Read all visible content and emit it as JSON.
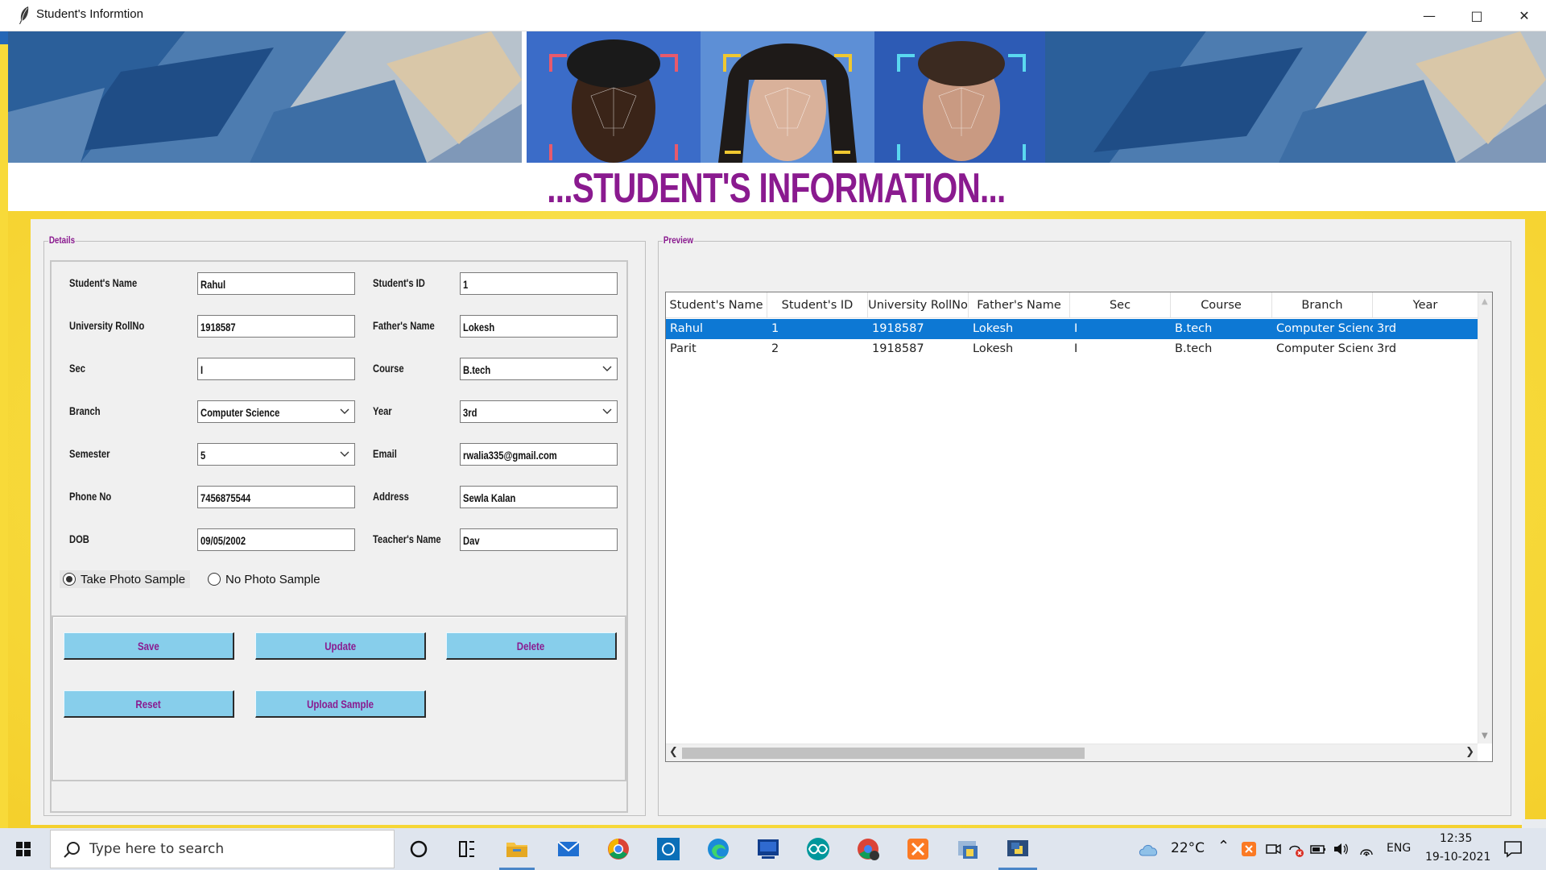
{
  "window": {
    "title": "Student's Informtion"
  },
  "heading": "...STUDENT'S INFORMATION...",
  "details": {
    "group_label": "Details",
    "fields": {
      "student_name": {
        "label": "Student's Name",
        "value": "Rahul"
      },
      "student_id": {
        "label": "Student's ID",
        "value": "1"
      },
      "university_rollno": {
        "label": "University RollNo",
        "value": "1918587"
      },
      "father_name": {
        "label": "Father's Name",
        "value": "Lokesh"
      },
      "sec": {
        "label": "Sec",
        "value": "I"
      },
      "course": {
        "label": "Course",
        "value": "B.tech"
      },
      "branch": {
        "label": "Branch",
        "value": "Computer Science"
      },
      "year": {
        "label": "Year",
        "value": "3rd"
      },
      "semester": {
        "label": "Semester",
        "value": "5"
      },
      "email": {
        "label": "Email",
        "value": "rwalia335@gmail.com"
      },
      "phone": {
        "label": "Phone No",
        "value": "7456875544"
      },
      "address": {
        "label": "Address",
        "value": "Sewla Kalan"
      },
      "dob": {
        "label": "DOB",
        "value": "09/05/2002"
      },
      "teacher": {
        "label": "Teacher's Name",
        "value": "Dav"
      }
    },
    "radios": {
      "take_photo": {
        "label": "Take Photo Sample",
        "selected": true
      },
      "no_photo": {
        "label": "No Photo Sample",
        "selected": false
      }
    },
    "buttons": {
      "save": "Save",
      "update": "Update",
      "delete": "Delete",
      "reset": "Reset",
      "upload": "Upload Sample"
    }
  },
  "preview": {
    "group_label": "Preview",
    "columns": [
      "Student's Name",
      "Student's ID",
      "University RollNo",
      "Father's Name",
      "Sec",
      "Course",
      "Branch",
      "Year"
    ],
    "rows": [
      {
        "cells": [
          "Rahul",
          "1",
          "1918587",
          "Lokesh",
          "I",
          "B.tech",
          "Computer Scienc",
          "3rd"
        ],
        "selected": true
      },
      {
        "cells": [
          "Parit",
          "2",
          "1918587",
          "Lokesh",
          "I",
          "B.tech",
          "Computer Scienc",
          "3rd"
        ],
        "selected": false
      }
    ]
  },
  "taskbar": {
    "search_placeholder": "Type here to search",
    "weather": "22°C",
    "language": "ENG",
    "time": "12:35",
    "date": "19-10-2021"
  },
  "colors": {
    "accent_purple": "#8a1a8f",
    "button_blue": "#87ceeb",
    "selection_blue": "#0d78d4",
    "frame_yellow": "#f8da39"
  }
}
